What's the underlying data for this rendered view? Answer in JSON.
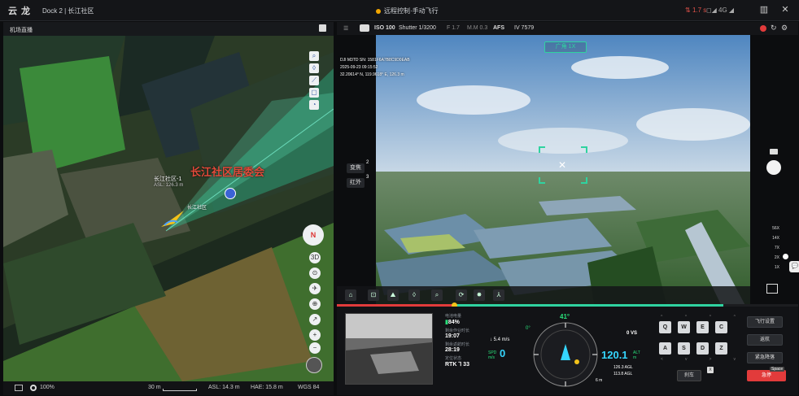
{
  "topbar": {
    "logo": "云 龙",
    "title": "Dock 2 | 长江社区",
    "status": "远程控制·手动飞行",
    "network": "1.7 s",
    "signal": "◻◢ 4G ◢",
    "grid_icon": "▥",
    "close": "✕"
  },
  "left": {
    "header": "机场直播",
    "map_labels": {
      "village_name": "长江社区居委会",
      "target_name": "长江社区-1",
      "target_asl": "ASL: 126.3 m",
      "dock_name": "长江社区"
    },
    "tools": [
      "⌕",
      "◊",
      "⟋",
      "▢",
      "◔"
    ],
    "compass": "N",
    "right_tools": [
      "3D",
      "⊙",
      "✈",
      "⊕",
      "↗",
      "+",
      "−"
    ],
    "footer": {
      "zoom": "100%",
      "scale": "30 m",
      "asl": "ASL: 14.3 m",
      "hae": "HAE: 15.8 m",
      "datum": "WGS 84"
    }
  },
  "camera": {
    "iso": "ISO 100",
    "shutter": "Shutter 1/3200",
    "fstop": "F 1.7",
    "mode": "M.M 0.3",
    "focus": "AFS",
    "ev": "IV 7579",
    "lens_badge": "广角 1X",
    "osd_model": "DJI M3TD  SN: 1581F6A7B8C9D0EAB",
    "osd_time": "2025-09-23  09:15:52",
    "osd_coords": "32.20614° N, 119.9618° E, 126.3 m",
    "left_buttons": [
      {
        "label": "变焦",
        "badge": "2"
      },
      {
        "label": "红外",
        "badge": "3"
      }
    ],
    "zoom_levels": [
      "56X",
      "14X",
      "7X",
      "2X",
      "1X"
    ],
    "chat_icon": "💬",
    "strip_icons": [
      "⌂",
      "⊡",
      "⛰",
      "◊",
      "⌕",
      "⟳",
      "✸",
      "⅄"
    ]
  },
  "hud": {
    "battery_label": "电池电量",
    "battery": "84%",
    "flight_time_label": "剩余作业时长",
    "flight_time": "19:07",
    "return_time_label": "剩余返航时长",
    "return_time": "28:19",
    "rtk_label": "定位状态",
    "rtk": "RTK ⅂ 33",
    "wind": "↓ 5.4 m/s",
    "spd_label": "SPD m/s",
    "spd": "0",
    "heading": "41°",
    "heading_small": "0°",
    "vs": "0 VS",
    "alt": "120.1",
    "alt_unit": "ALT m",
    "agl1": "126.3 AGL",
    "agl2": "113.8 AGL",
    "dist": "6 m",
    "keys_row1": [
      "Q",
      "W",
      "E",
      "C"
    ],
    "keys_row2": [
      "A",
      "S",
      "D",
      "Z"
    ],
    "keys_caret": [
      "^",
      "^",
      "^",
      "^"
    ],
    "keys_caret2": [
      "<",
      "v",
      ">",
      "v"
    ],
    "brake_btn": "刹车",
    "action_buttons": [
      "飞行设置",
      "返航",
      "紧急降落"
    ],
    "stop_btn": "急停",
    "space_tag": "Space",
    "x_tag": "X"
  },
  "colors": {
    "accent": "#2fd3a0",
    "alert": "#e23b3b",
    "hud_cyan": "#35d6ff",
    "hud_green": "#29e07a"
  }
}
